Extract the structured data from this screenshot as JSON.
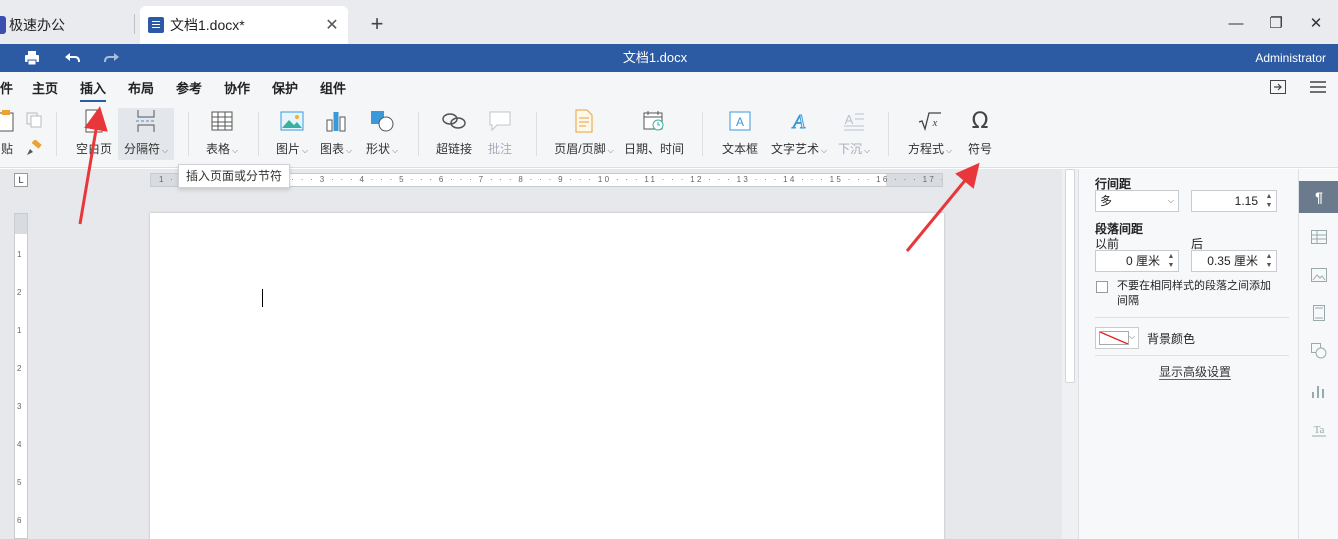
{
  "tabbar": {
    "app_tab_label": "极速办公",
    "doc_tab_label": "文档1.docx*",
    "close_glyph": "✕",
    "new_tab_glyph": "+",
    "minimize_glyph": "—",
    "restore_glyph": "❐",
    "close_window_glyph": "✕"
  },
  "titlebar": {
    "title": "文档1.docx",
    "user": "Administrator"
  },
  "menu": {
    "items": [
      "件",
      "主页",
      "插入",
      "布局",
      "参考",
      "协作",
      "保护",
      "组件"
    ],
    "active": "插入"
  },
  "toolbar": {
    "paste": "贴",
    "blank_page": "空白页",
    "break": "分隔符",
    "table": "表格",
    "picture": "图片",
    "chart": "图表",
    "shape": "形状",
    "hyperlink": "超链接",
    "comment": "批注",
    "header_footer": "页眉/页脚",
    "date_time": "日期、时间",
    "textbox": "文本框",
    "wordart": "文字艺术",
    "dropcap": "下沉",
    "equation": "方程式",
    "symbol": "符号"
  },
  "tooltip": "插入页面或分节符",
  "ruler": {
    "ticks": "1 · 2 · 1 · · · 1 · · · 2 · · · 3 · · · 4 · · · 5 · · · 6 · · · 7 · · · 8 · · · 9 · · · 10 · · · 11 · · · 12 · · · 13 · · · 14 · · · 15 · · · 16 · · · 17 ·"
  },
  "vertical_ruler_ticks": [
    "1",
    "2",
    "1",
    "2",
    "3",
    "4",
    "5",
    "6"
  ],
  "sidepanel": {
    "line_spacing_label": "行间距",
    "line_spacing_mode": "多",
    "line_spacing_value": "1.15",
    "paragraph_spacing_label": "段落间距",
    "before_label": "以前",
    "after_label": "后",
    "before_value": "0 厘米",
    "after_value": "0.35 厘米",
    "no_space_same_style": "不要在相同样式的段落之间添加间隔",
    "background_color_label": "背景颜色",
    "advanced_settings": "显示高级设置"
  },
  "colors": {
    "title_blue": "#2d5ba3",
    "annotation_red": "#e8373a"
  }
}
